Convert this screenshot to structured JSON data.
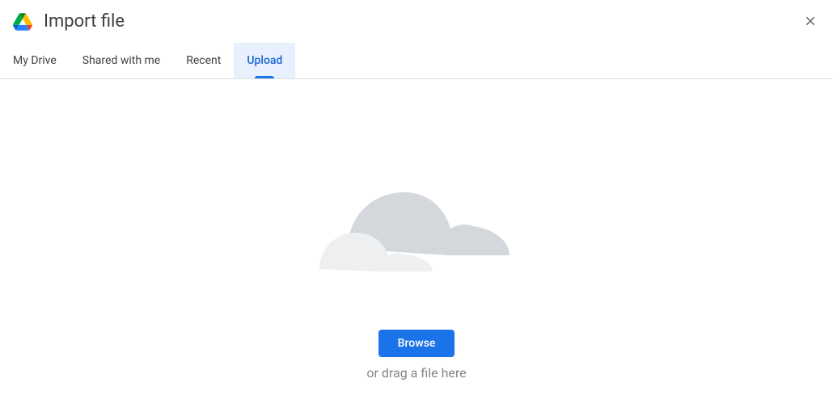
{
  "header": {
    "title": "Import file"
  },
  "tabs": {
    "my_drive": "My Drive",
    "shared_with_me": "Shared with me",
    "recent": "Recent",
    "upload": "Upload"
  },
  "upload": {
    "browse_label": "Browse",
    "drag_text": "or drag a file here"
  }
}
